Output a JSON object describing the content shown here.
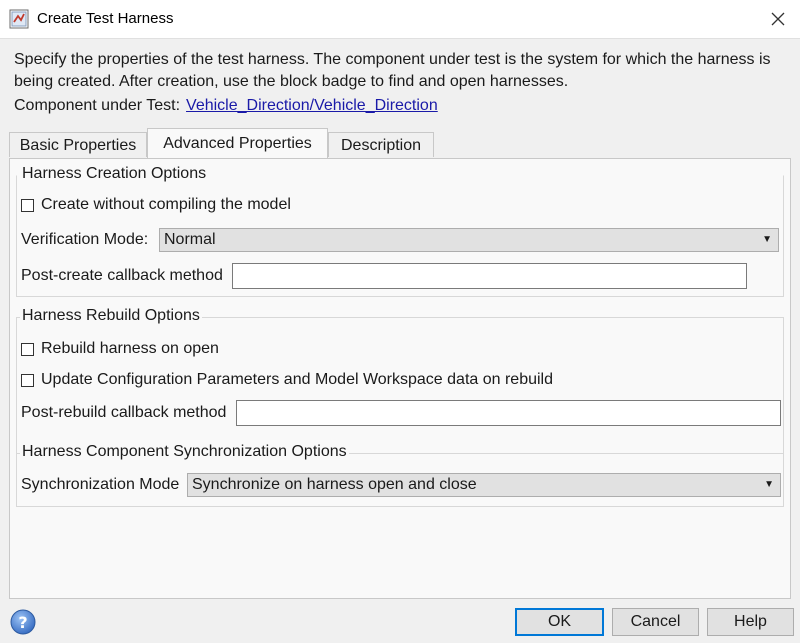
{
  "window": {
    "title": "Create Test Harness",
    "icon": "simulink-icon",
    "close_icon": "close-icon"
  },
  "description": "Specify the properties of the test harness. The component under test is the system for which the harness is being created. After creation, use the block badge to find and open harnesses.",
  "component_under_test": {
    "label": "Component under Test:",
    "value": "Vehicle_Direction/Vehicle_Direction"
  },
  "tabs": [
    {
      "label": "Basic Properties",
      "active": false
    },
    {
      "label": "Advanced Properties",
      "active": true
    },
    {
      "label": "Description",
      "active": false
    }
  ],
  "harness_creation": {
    "title": "Harness Creation Options",
    "create_without_compiling": {
      "label": "Create without compiling the model",
      "checked": false
    },
    "verification_mode": {
      "label": "Verification Mode:",
      "value": "Normal"
    },
    "post_create_callback": {
      "label": "Post-create callback method",
      "value": ""
    }
  },
  "harness_rebuild": {
    "title": "Harness Rebuild Options",
    "rebuild_on_open": {
      "label": "Rebuild harness on open",
      "checked": false
    },
    "update_config": {
      "label": "Update Configuration Parameters and Model Workspace data on rebuild",
      "checked": false
    },
    "post_rebuild_callback": {
      "label": "Post-rebuild callback method",
      "value": ""
    }
  },
  "harness_sync": {
    "title": "Harness Component Synchronization Options",
    "sync_mode": {
      "label": "Synchronization Mode",
      "value": "Synchronize on harness open and close"
    }
  },
  "footer": {
    "help_icon": "question-icon",
    "ok_label": "OK",
    "cancel_label": "Cancel",
    "help_label": "Help"
  },
  "colors": {
    "link": "#1a1aa8",
    "default_button_border": "#0078d7",
    "help_icon_blue": "#3a6fc4"
  }
}
